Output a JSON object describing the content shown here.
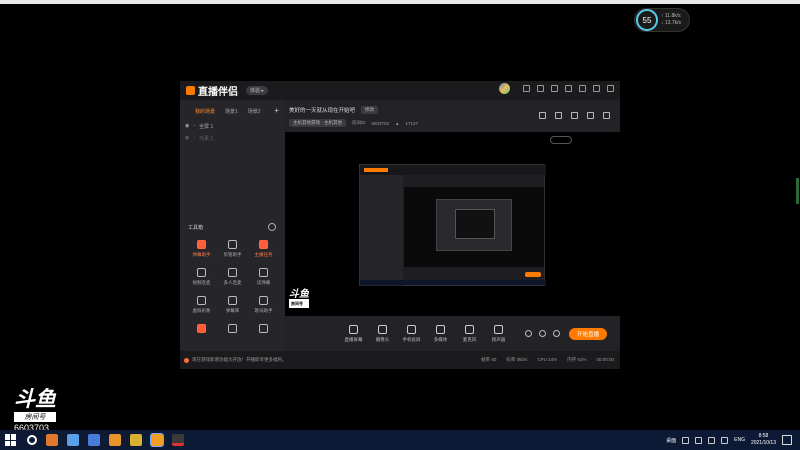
{
  "speed_widget": {
    "percent": "55",
    "up": "↑ 11.8k/s",
    "down": "↓ 13.7k/s"
  },
  "app": {
    "name": "直播伴侣",
    "version_badge": "体验 ▸",
    "scene_tabs": [
      "我的场景",
      "场景1",
      "场景2"
    ],
    "scene_add": "+",
    "sources": [
      "全屏 1",
      "元素 1"
    ],
    "tools_heading": "工具箱",
    "tools": [
      {
        "label": "弹幕助手",
        "hot": true
      },
      {
        "label": "房管助手",
        "hot": false
      },
      {
        "label": "主播任务",
        "hot": true
      },
      {
        "label": "视频连麦",
        "hot": false
      },
      {
        "label": "多人连麦",
        "hot": false
      },
      {
        "label": "读弹幕",
        "hot": false
      },
      {
        "label": "虚拟形象",
        "hot": false
      },
      {
        "label": "弹幕库",
        "hot": false
      },
      {
        "label": "歌词助手",
        "hot": false
      },
      {
        "label": "",
        "hot": false
      },
      {
        "label": "",
        "hot": false
      },
      {
        "label": "",
        "hot": false
      }
    ],
    "stream_title": "美好的一天就从现在开始吧",
    "edit_label": "修改",
    "category": "主机其他游戏 · 主机其他",
    "room_label": "房间ID",
    "room_id": "6603703",
    "hot_value": "17127",
    "controls": [
      "直播屏幕",
      "摄像头",
      "手机投屏",
      "多媒体",
      "麦克风",
      "扬声器"
    ],
    "go_live": "开始直播",
    "notice": "现在游戏新增功能大开放！开播即享更多福利。",
    "stats": [
      "帧率 60",
      "码率 0kb/s",
      "CPU 24%",
      "内存 61%",
      "00:00:00"
    ]
  },
  "watermark": {
    "logo": "斗鱼",
    "tag": "房间号",
    "room": "6603703"
  },
  "taskbar": {
    "tray_text": "桌面",
    "lang": "ENG",
    "time": "8:58",
    "date": "2021/10/13"
  }
}
